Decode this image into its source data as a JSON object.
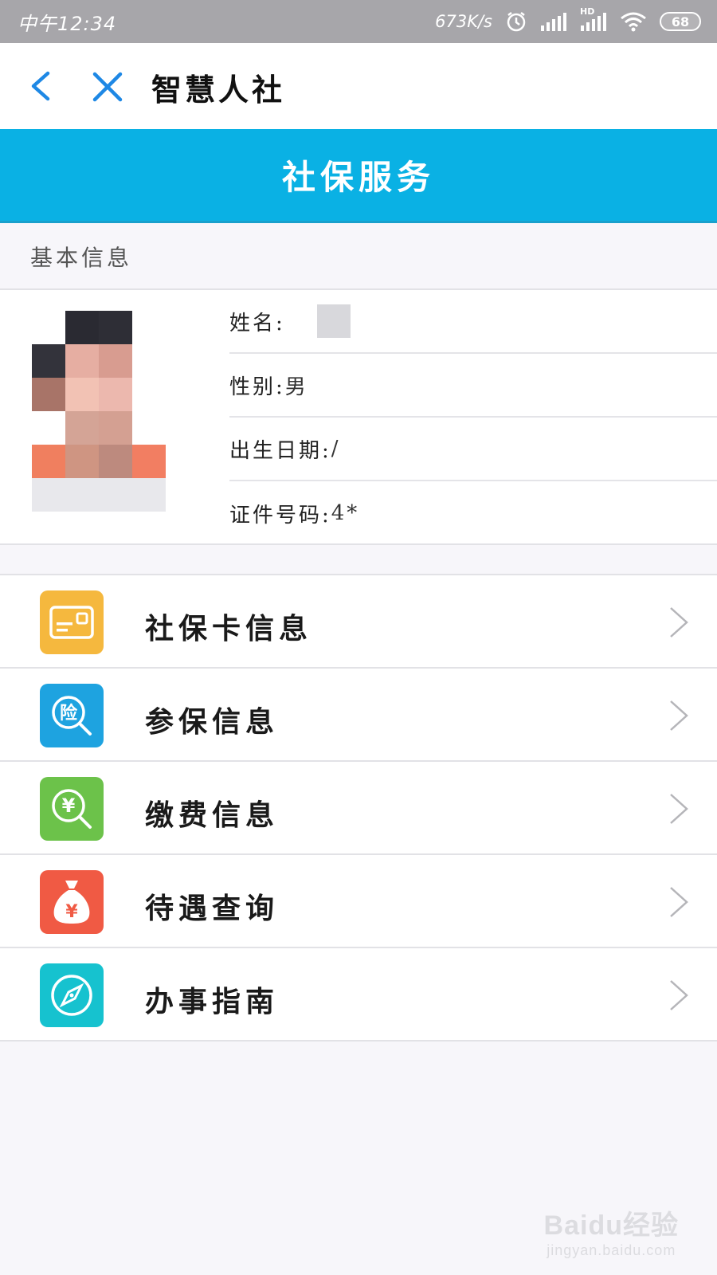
{
  "status_bar": {
    "time": "中午12:34",
    "net_speed": "673K/s",
    "battery": "68",
    "signal_hd": "HD"
  },
  "nav": {
    "title": "智慧人社"
  },
  "service": {
    "title": "社保服务"
  },
  "basic_info": {
    "section_label": "基本信息",
    "rows": [
      {
        "label": "姓名:",
        "value": ""
      },
      {
        "label": "性别:",
        "value": "男"
      },
      {
        "label": "出生日期:",
        "value": "/"
      },
      {
        "label": "证件号码:",
        "value": "4*"
      }
    ]
  },
  "menu": {
    "items": [
      {
        "label": "社保卡信息",
        "icon": "card-icon",
        "color": "#f5b83e"
      },
      {
        "label": "参保信息",
        "icon": "insurance-search-icon",
        "color": "#1ea3e0",
        "glyph": "险"
      },
      {
        "label": "缴费信息",
        "icon": "payment-search-icon",
        "color": "#6cc24a",
        "glyph": "¥"
      },
      {
        "label": "待遇查询",
        "icon": "money-bag-icon",
        "color": "#f05a44",
        "glyph": "¥"
      },
      {
        "label": "办事指南",
        "icon": "compass-icon",
        "color": "#16c2cf"
      }
    ]
  },
  "watermark": {
    "main": "Baidu经验",
    "sub": "jingyan.baidu.com"
  }
}
